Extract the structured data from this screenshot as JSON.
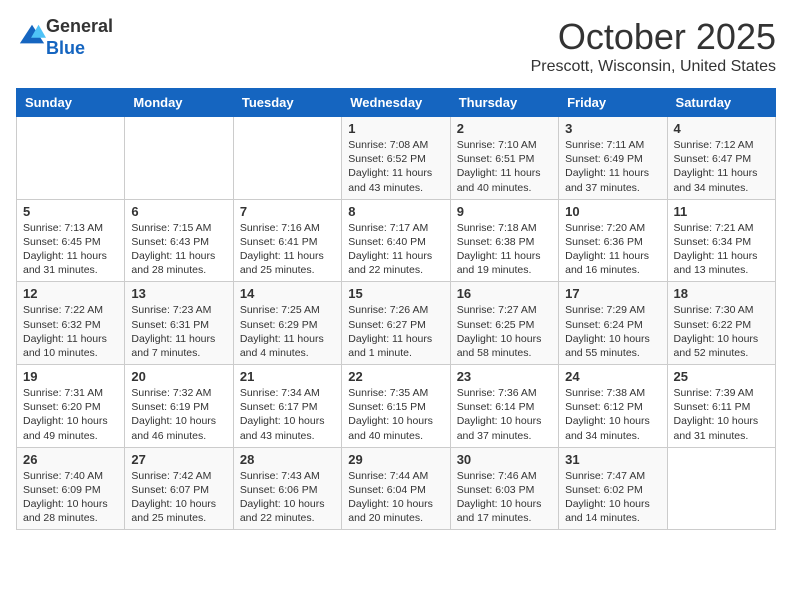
{
  "logo": {
    "general": "General",
    "blue": "Blue"
  },
  "title": "October 2025",
  "location": "Prescott, Wisconsin, United States",
  "days_header": [
    "Sunday",
    "Monday",
    "Tuesday",
    "Wednesday",
    "Thursday",
    "Friday",
    "Saturday"
  ],
  "weeks": [
    [
      {
        "num": "",
        "info": ""
      },
      {
        "num": "",
        "info": ""
      },
      {
        "num": "",
        "info": ""
      },
      {
        "num": "1",
        "info": "Sunrise: 7:08 AM\nSunset: 6:52 PM\nDaylight: 11 hours\nand 43 minutes."
      },
      {
        "num": "2",
        "info": "Sunrise: 7:10 AM\nSunset: 6:51 PM\nDaylight: 11 hours\nand 40 minutes."
      },
      {
        "num": "3",
        "info": "Sunrise: 7:11 AM\nSunset: 6:49 PM\nDaylight: 11 hours\nand 37 minutes."
      },
      {
        "num": "4",
        "info": "Sunrise: 7:12 AM\nSunset: 6:47 PM\nDaylight: 11 hours\nand 34 minutes."
      }
    ],
    [
      {
        "num": "5",
        "info": "Sunrise: 7:13 AM\nSunset: 6:45 PM\nDaylight: 11 hours\nand 31 minutes."
      },
      {
        "num": "6",
        "info": "Sunrise: 7:15 AM\nSunset: 6:43 PM\nDaylight: 11 hours\nand 28 minutes."
      },
      {
        "num": "7",
        "info": "Sunrise: 7:16 AM\nSunset: 6:41 PM\nDaylight: 11 hours\nand 25 minutes."
      },
      {
        "num": "8",
        "info": "Sunrise: 7:17 AM\nSunset: 6:40 PM\nDaylight: 11 hours\nand 22 minutes."
      },
      {
        "num": "9",
        "info": "Sunrise: 7:18 AM\nSunset: 6:38 PM\nDaylight: 11 hours\nand 19 minutes."
      },
      {
        "num": "10",
        "info": "Sunrise: 7:20 AM\nSunset: 6:36 PM\nDaylight: 11 hours\nand 16 minutes."
      },
      {
        "num": "11",
        "info": "Sunrise: 7:21 AM\nSunset: 6:34 PM\nDaylight: 11 hours\nand 13 minutes."
      }
    ],
    [
      {
        "num": "12",
        "info": "Sunrise: 7:22 AM\nSunset: 6:32 PM\nDaylight: 11 hours\nand 10 minutes."
      },
      {
        "num": "13",
        "info": "Sunrise: 7:23 AM\nSunset: 6:31 PM\nDaylight: 11 hours\nand 7 minutes."
      },
      {
        "num": "14",
        "info": "Sunrise: 7:25 AM\nSunset: 6:29 PM\nDaylight: 11 hours\nand 4 minutes."
      },
      {
        "num": "15",
        "info": "Sunrise: 7:26 AM\nSunset: 6:27 PM\nDaylight: 11 hours\nand 1 minute."
      },
      {
        "num": "16",
        "info": "Sunrise: 7:27 AM\nSunset: 6:25 PM\nDaylight: 10 hours\nand 58 minutes."
      },
      {
        "num": "17",
        "info": "Sunrise: 7:29 AM\nSunset: 6:24 PM\nDaylight: 10 hours\nand 55 minutes."
      },
      {
        "num": "18",
        "info": "Sunrise: 7:30 AM\nSunset: 6:22 PM\nDaylight: 10 hours\nand 52 minutes."
      }
    ],
    [
      {
        "num": "19",
        "info": "Sunrise: 7:31 AM\nSunset: 6:20 PM\nDaylight: 10 hours\nand 49 minutes."
      },
      {
        "num": "20",
        "info": "Sunrise: 7:32 AM\nSunset: 6:19 PM\nDaylight: 10 hours\nand 46 minutes."
      },
      {
        "num": "21",
        "info": "Sunrise: 7:34 AM\nSunset: 6:17 PM\nDaylight: 10 hours\nand 43 minutes."
      },
      {
        "num": "22",
        "info": "Sunrise: 7:35 AM\nSunset: 6:15 PM\nDaylight: 10 hours\nand 40 minutes."
      },
      {
        "num": "23",
        "info": "Sunrise: 7:36 AM\nSunset: 6:14 PM\nDaylight: 10 hours\nand 37 minutes."
      },
      {
        "num": "24",
        "info": "Sunrise: 7:38 AM\nSunset: 6:12 PM\nDaylight: 10 hours\nand 34 minutes."
      },
      {
        "num": "25",
        "info": "Sunrise: 7:39 AM\nSunset: 6:11 PM\nDaylight: 10 hours\nand 31 minutes."
      }
    ],
    [
      {
        "num": "26",
        "info": "Sunrise: 7:40 AM\nSunset: 6:09 PM\nDaylight: 10 hours\nand 28 minutes."
      },
      {
        "num": "27",
        "info": "Sunrise: 7:42 AM\nSunset: 6:07 PM\nDaylight: 10 hours\nand 25 minutes."
      },
      {
        "num": "28",
        "info": "Sunrise: 7:43 AM\nSunset: 6:06 PM\nDaylight: 10 hours\nand 22 minutes."
      },
      {
        "num": "29",
        "info": "Sunrise: 7:44 AM\nSunset: 6:04 PM\nDaylight: 10 hours\nand 20 minutes."
      },
      {
        "num": "30",
        "info": "Sunrise: 7:46 AM\nSunset: 6:03 PM\nDaylight: 10 hours\nand 17 minutes."
      },
      {
        "num": "31",
        "info": "Sunrise: 7:47 AM\nSunset: 6:02 PM\nDaylight: 10 hours\nand 14 minutes."
      },
      {
        "num": "",
        "info": ""
      }
    ]
  ]
}
